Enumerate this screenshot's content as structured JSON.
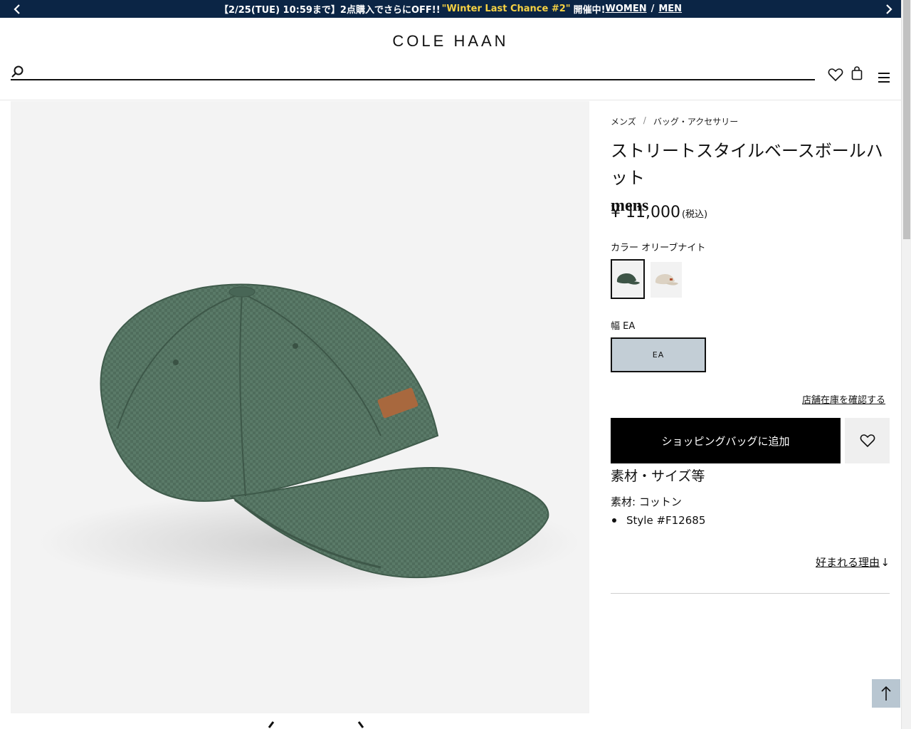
{
  "promo": {
    "text_main": "【2/25(TUE) 10:59まで】2点購入でさらにOFF!!",
    "text_highlight": "\"Winter Last Chance #2\"",
    "text_after": "開催中!",
    "link_women": "WOMEN",
    "separator": "/",
    "link_men": "MEN"
  },
  "header": {
    "logo": "COLE HAAN",
    "search_placeholder": ""
  },
  "breadcrumb": {
    "items": [
      "メンズ",
      "バッグ・アクセサリー"
    ],
    "separator": "/"
  },
  "product": {
    "title": "ストリートスタイルベースボールハット",
    "subtitle": "mens",
    "price": "¥ 11,000",
    "tax_note": "(税込)",
    "color_label": "カラー",
    "color_value": "オリーブナイト",
    "width_label": "幅",
    "width_value": "EA",
    "size_option": "EA",
    "store_stock_link": "店舗在庫を確認する",
    "add_to_bag": "ショッピングバッグに追加",
    "spec_heading": "素材・サイズ等",
    "material": "素材: コットン",
    "style_number": "Style #F12685",
    "reason_link": "好まれる理由",
    "reason_arrow": "↓"
  },
  "colors": {
    "promo_bg": "#0b2545",
    "promo_highlight": "#f5d142",
    "hat_green": "#4f6d5c",
    "size_selected_bg": "#c3ced6",
    "to_top_bg": "#b8c6d1"
  }
}
